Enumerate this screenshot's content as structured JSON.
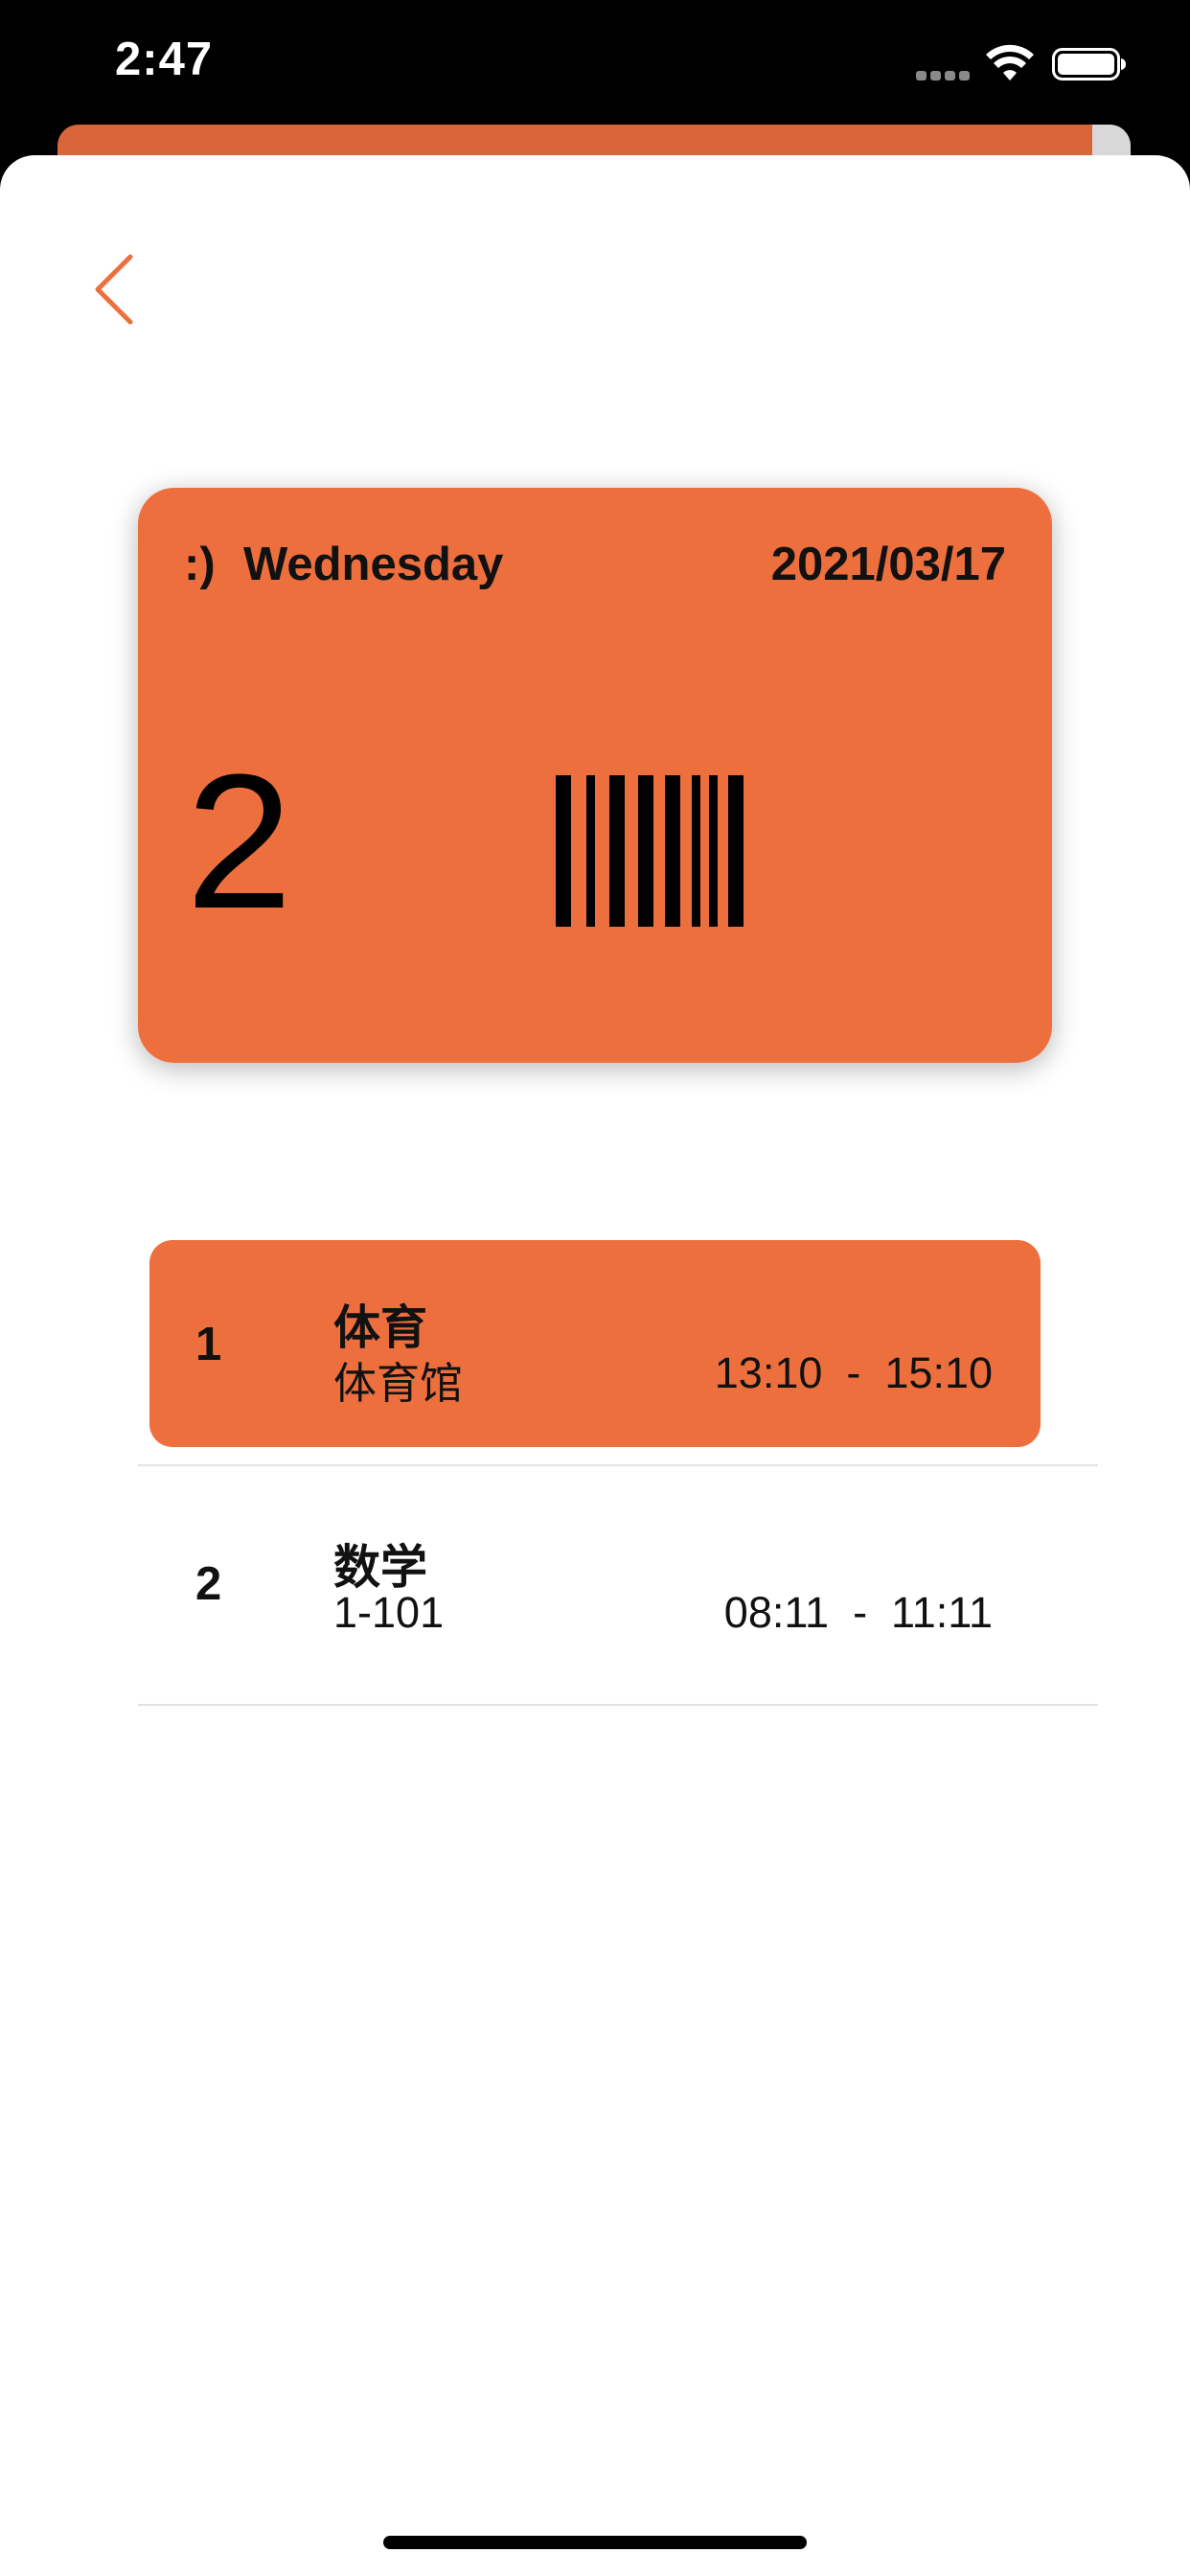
{
  "status_bar": {
    "time": "2:47",
    "icons": [
      "signal-icon",
      "wifi-icon",
      "battery-icon"
    ]
  },
  "colors": {
    "accent": "#ee6f3e",
    "back_card": "#d9663a",
    "background": "#ffffff",
    "text": "#111111"
  },
  "nav": {
    "back_icon": "chevron-left-icon"
  },
  "card": {
    "emoticon": ":)",
    "weekday": "Wednesday",
    "date": "2021/03/17",
    "count": "2",
    "barcode_icon": "barcode-icon"
  },
  "classes": [
    {
      "index": "1",
      "subject": "体育",
      "location": "体育馆",
      "time": "13:10  -  15:10",
      "highlighted": true
    },
    {
      "index": "2",
      "subject": "数学",
      "location": "1-101",
      "time": "08:11  -  11:11",
      "highlighted": false
    }
  ]
}
